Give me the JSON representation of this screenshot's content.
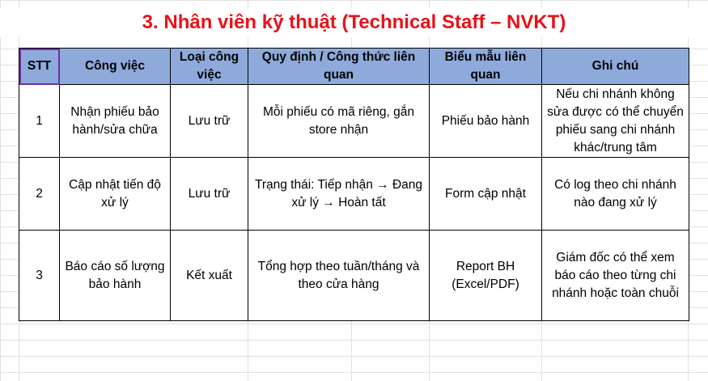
{
  "title": "3. Nhân viên kỹ thuật (Technical Staff – NVKT)",
  "headers": {
    "stt": "STT",
    "cong_viec": "Công việc",
    "loai_cong_viec": "Loại công việc",
    "quy_dinh": "Quy định / Công thức liên quan",
    "bieu_mau": "Biểu mẫu liên quan",
    "ghi_chu": "Ghi chú"
  },
  "rows": [
    {
      "stt": "1",
      "cong_viec": "Nhận phiếu bảo hành/sửa chữa",
      "loai": "Lưu trữ",
      "quy_dinh": "Mỗi phiếu có mã riêng, gắn store nhận",
      "bieu_mau": "Phiếu bảo hành",
      "ghi_chu": "Nếu chi nhánh không sửa được có thể chuyển phiếu sang chi nhánh khác/trung tâm"
    },
    {
      "stt": "2",
      "cong_viec": "Cập nhật tiến độ xử lý",
      "loai": "Lưu trữ",
      "quy_dinh": "Trạng thái: Tiếp nhận → Đang xử lý → Hoàn tất",
      "bieu_mau": "Form cập nhật",
      "ghi_chu": "Có log theo chi nhánh nào đang xử lý"
    },
    {
      "stt": "3",
      "cong_viec": "Báo cáo số lượng bảo hành",
      "loai": "Kết xuất",
      "quy_dinh": "Tổng hợp theo tuần/tháng và theo cửa hàng",
      "bieu_mau": "Report BH (Excel/PDF)",
      "ghi_chu": "Giám đốc có thể xem báo cáo theo từng chi nhánh hoặc toàn chuỗi"
    }
  ],
  "colors": {
    "title": "#e8121a",
    "header_bg": "#8eaadb",
    "selection": "#7030a0"
  }
}
